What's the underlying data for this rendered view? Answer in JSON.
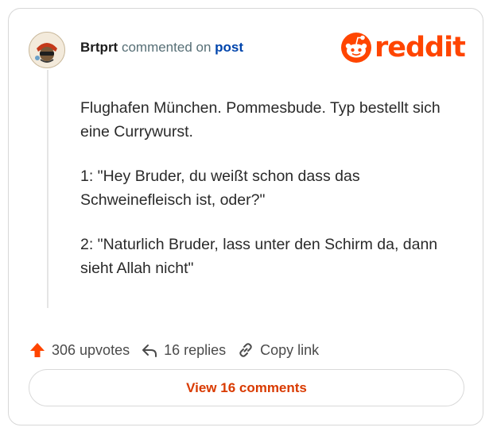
{
  "header": {
    "author": "Brtprt",
    "commented_text": "commented on",
    "post_link": "post"
  },
  "brand": {
    "name": "reddit",
    "icon": "reddit-alien-icon",
    "color": "#ff4500"
  },
  "comment": {
    "paragraphs": [
      "Flughafen München. Pommesbude. Typ bestellt sich eine Currywurst.",
      "1: \"Hey Bruder, du weißt schon dass das Schweinefleisch ist, oder?\"",
      "2: \"Naturlich Bruder, lass unter den Schirm da, dann sieht Allah nicht\""
    ]
  },
  "actions": {
    "upvotes": "306 upvotes",
    "replies": "16 replies",
    "copy_link": "Copy link",
    "upvote_icon": "upvote-arrow-icon",
    "reply_icon": "reply-arrow-icon",
    "link_icon": "link-icon",
    "upvote_color": "#ff4500"
  },
  "view_comments": "View 16 comments"
}
